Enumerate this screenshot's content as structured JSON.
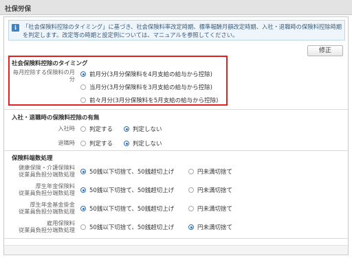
{
  "header": {
    "title": "社保労保"
  },
  "info": {
    "icon": "info-icon",
    "message": "「社会保険料控除のタイミング」に基づき、社会保険料率改定時期、標準報酬月額改定時期、入社・退職時の保険料控除時期を判定します。改定等の時期と設定例については、マニュアルを参照してください。"
  },
  "edit_button": "修正",
  "timing": {
    "title": "社会保険料控除のタイミング",
    "label": "毎月控除する保険料の月分",
    "options": [
      {
        "label": "前月分(3月分保険料を4月支給の給与から控除)",
        "selected": true
      },
      {
        "label": "当月分(3月分保険料を3月支給の給与から控除)",
        "selected": false
      },
      {
        "label": "前々月分(3月分保険料を5月支給の給与から控除)",
        "selected": false
      }
    ]
  },
  "join_leave": {
    "title": "入社・退職時の保険料控除の有無",
    "rows": [
      {
        "label": "入社時",
        "opt1": "判定する",
        "opt2": "判定しない",
        "selected": 2
      },
      {
        "label": "退職時",
        "opt1": "判定する",
        "opt2": "判定しない",
        "selected": 2
      }
    ]
  },
  "rounding": {
    "title": "保険料端数処理",
    "opt1": "50銭以下切捨て、50銭超切上げ",
    "opt2": "円未満切捨て",
    "rows": [
      {
        "label_line1": "健康保険・介護保険料",
        "label_line2": "従業員負担分端数処理",
        "selected": 1
      },
      {
        "label_line1": "厚生年金保険料",
        "label_line2": "従業員負担分端数処理",
        "selected": 1
      },
      {
        "label_line1": "厚生年金基金掛金",
        "label_line2": "従業員負担分端数処理",
        "selected": 1
      },
      {
        "label_line1": "雇用保険料",
        "label_line2": "従業員負担分端数処理",
        "selected": 2
      }
    ]
  },
  "colors": {
    "accent": "#2a6db5",
    "highlight": "#e02020",
    "info_bg": "#eef5fb"
  }
}
